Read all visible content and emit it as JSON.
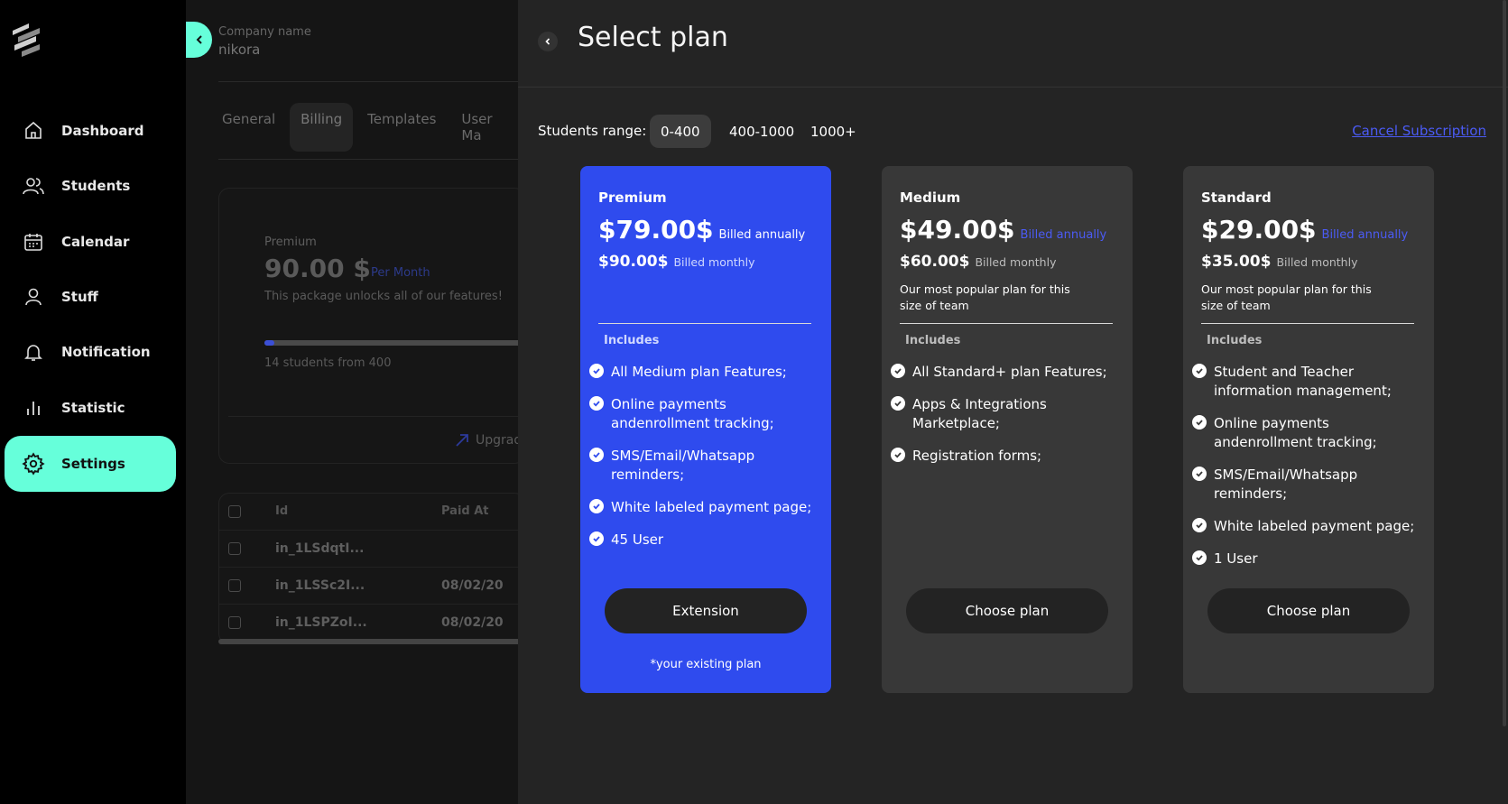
{
  "sidebar": {
    "items": [
      {
        "label": "Dashboard",
        "icon": "home-icon"
      },
      {
        "label": "Students",
        "icon": "users-icon"
      },
      {
        "label": "Calendar",
        "icon": "calendar-icon"
      },
      {
        "label": "Stuff",
        "icon": "user-icon"
      },
      {
        "label": "Notification",
        "icon": "bell-icon"
      },
      {
        "label": "Statistic",
        "icon": "bar-chart-icon"
      },
      {
        "label": "Settings",
        "icon": "gear-icon",
        "active": true
      }
    ]
  },
  "background": {
    "company_label": "Company name",
    "company_name": "nikora",
    "tabs": [
      "General",
      "Billing",
      "Templates",
      "User Ma"
    ],
    "active_tab": "Billing",
    "current_plan": {
      "name": "Premium",
      "price": "90.00 $",
      "period": "Per Month",
      "description": "This package unlocks all of our features!",
      "students": "14 students from 400",
      "upgrade_label": "Upgrad",
      "progress": 0.035
    },
    "table": {
      "headers": [
        "Id",
        "Paid At"
      ],
      "rows": [
        {
          "id": "in_1LSdqtI...",
          "paid_at": ""
        },
        {
          "id": "in_1LSSc2I...",
          "paid_at": "08/02/20"
        },
        {
          "id": "in_1LSPZoI...",
          "paid_at": "08/02/20"
        }
      ]
    }
  },
  "drawer": {
    "title": "Select plan",
    "range_label": "Students range:",
    "ranges": [
      "0-400",
      "400-1000",
      "1000+"
    ],
    "active_range": "0-400",
    "cancel_label": "Cancel Subscription",
    "plans": [
      {
        "name": "Premium",
        "price_annual": "$79.00$",
        "annual_note": "Billed annually",
        "price_monthly": "$90.00$",
        "monthly_note": "Billed monthly",
        "description": "",
        "includes_label": "Includes",
        "features": [
          "All Medium plan Features;",
          "Online payments andenrollment tracking;",
          "SMS/Email/Whatsapp reminders;",
          "White labeled payment page;",
          "45 User"
        ],
        "button_label": "Extension",
        "existing_note": "*your existing plan",
        "selected": true
      },
      {
        "name": "Medium",
        "price_annual": "$49.00$",
        "annual_note": "Billed annually",
        "price_monthly": "$60.00$",
        "monthly_note": "Billed monthly",
        "description": "Our most popular plan for this size of team",
        "includes_label": "Includes",
        "features": [
          "All Standard+ plan Features;",
          "Apps & Integrations Marketplace;",
          "Registration forms;"
        ],
        "button_label": "Choose plan",
        "existing_note": "",
        "selected": false
      },
      {
        "name": "Standard",
        "price_annual": "$29.00$",
        "annual_note": "Billed annually",
        "price_monthly": "$35.00$",
        "monthly_note": "Billed monthly",
        "description": "Our most popular plan for this size of team",
        "includes_label": "Includes",
        "features": [
          "Student and Teacher information management;",
          "Online payments andenrollment tracking;",
          "SMS/Email/Whatsapp reminders;",
          "White labeled payment page;",
          "1 User"
        ],
        "button_label": "Choose plan",
        "existing_note": "",
        "selected": false
      }
    ]
  },
  "colors": {
    "accent": "#66ffda",
    "selected_card": "#2f4bee",
    "card": "#383838",
    "drawer_bg": "#242424",
    "link": "#4b5bf5"
  }
}
